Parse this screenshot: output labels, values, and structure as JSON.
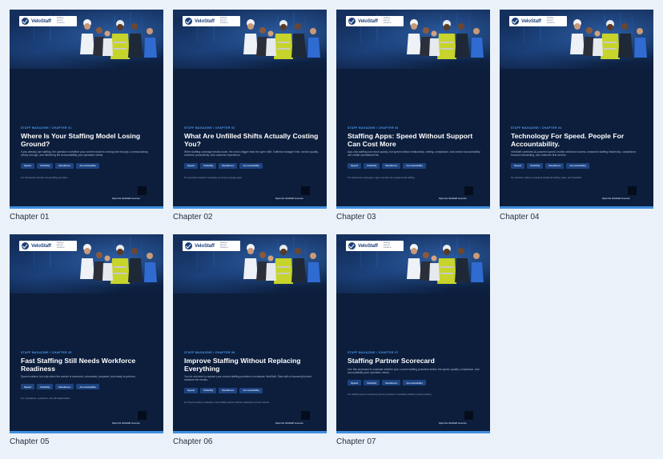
{
  "brand": {
    "logo_text": "VeloStaff",
    "logo_tagline": "Staffing partner solutions"
  },
  "tag_labels": [
    "Speed",
    "Visibility",
    "Readiness",
    "Accountability"
  ],
  "cta_label": "Open the VeloStaff resource",
  "chapters": [
    {
      "caption": "Chapter 01",
      "eyebrow": "Staff Magazine / Chapter 01",
      "title": "Where Is Your Staffing Model Losing Ground?",
      "description": "If you already use staffing, the question is whether your current model is moving fast enough, communicating clearly enough, and delivering the accountability your operation needs.",
      "footnote": "For businesses already using staffing providers"
    },
    {
      "caption": "Chapter 02",
      "eyebrow": "Staff Magazine / Chapter 02",
      "title": "What Are Unfilled Shifts Actually Costing You?",
      "description": "When staffing coverage breaks down, the cost is bigger than the open shift. It affects manager time, service quality, overtime, productivity, and customer experience.",
      "footnote": "For operations leaders managing recurring coverage gaps"
    },
    {
      "caption": "Chapter 03",
      "eyebrow": "Staff Magazine / Chapter 03",
      "title": "Staffing Apps: Speed Without Support Can Cost More",
      "description": "App-only staffing can move quickly, but speed without relationship, vetting, compliance, and service accountability can create operational risk.",
      "footnote": "For businesses using gig or app-only labor as supplemental staffing"
    },
    {
      "caption": "Chapter 04",
      "eyebrow": "Staff Magazine / Chapter 04",
      "title": "Technology For Speed. People For Accountability.",
      "description": "VeloStaff combines AI-powered speed, mobile workforce access, seasoned staffing leadership, compliance-focused onboarding, and customer-first service.",
      "footnote": "For decision-makers comparing traditional staffing, apps, and VeloStaff"
    },
    {
      "caption": "Chapter 05",
      "eyebrow": "Staff Magazine / Chapter 05",
      "title": "Fast Staffing Still Needs Workforce Readiness",
      "description": "Speed matters, but only when the worker is screened, onboarded, prepared, and ready to perform.",
      "footnote": "For compliance, operations, and HR stakeholders"
    },
    {
      "caption": "Chapter 06",
      "eyebrow": "Staff Magazine / Chapter 06",
      "title": "Improve Staffing Without Replacing Everything",
      "description": "You do not need to replace your current staffing providers to evaluate VeloStaff. Start with a focused pilot and measure the results.",
      "footnote": "For buyers ready to evaluate a new staffing partner without replacing a current vendor"
    },
    {
      "caption": "Chapter 07",
      "eyebrow": "Staff Magazine / Chapter 07",
      "title": "Staffing Partner Scorecard",
      "description": "Use this scorecard to evaluate whether your current staffing providers deliver the speed, quality, compliance, and accountability your operation needs.",
      "footnote": "For staffing buyers comparing current providers or deciding whether to add a backup"
    }
  ]
}
